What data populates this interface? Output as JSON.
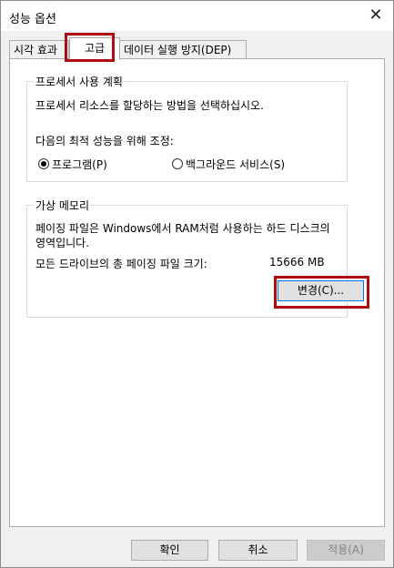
{
  "window": {
    "title": "성능 옵션",
    "close_glyph": "✕"
  },
  "tabs": [
    {
      "label": "시각 효과"
    },
    {
      "label": "고급"
    },
    {
      "label": "데이터 실행 방지(DEP)"
    }
  ],
  "processor": {
    "legend": "프로세서 사용 계획",
    "description": "프로세서 리소스를 할당하는 방법을 선택하십시오.",
    "adjust_label": "다음의 최적 성능을 위해 조정:",
    "options": [
      {
        "label": "프로그램(P)",
        "selected": true
      },
      {
        "label": "백그라운드 서비스(S)",
        "selected": false
      }
    ]
  },
  "virtual_memory": {
    "legend": "가상 메모리",
    "description_line1": "페이징 파일은 Windows에서 RAM처럼 사용하는 하드 디스크의",
    "description_line2": "영역입니다.",
    "total_label": "모든 드라이브의 총 페이징 파일 크기:",
    "total_value": "15666 MB",
    "change_button": "변경(C)..."
  },
  "buttons": {
    "ok": "확인",
    "cancel": "취소",
    "apply": "적용(A)"
  },
  "colors": {
    "highlight": "#b00d12",
    "focus": "#0078d7"
  }
}
